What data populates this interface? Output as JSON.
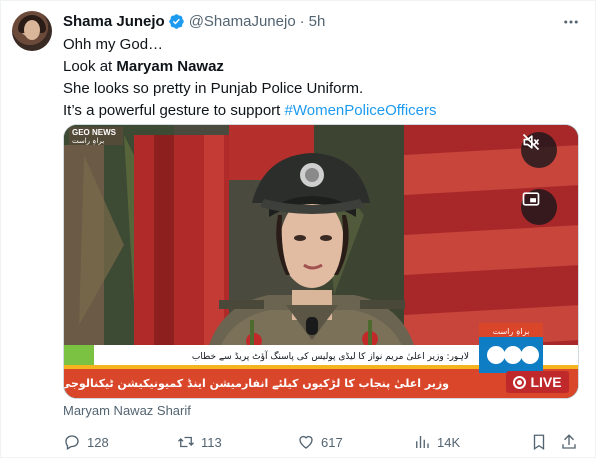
{
  "author": {
    "name": "Shama Junejo",
    "handle": "@ShamaJunejo",
    "separator": "·",
    "time": "5h"
  },
  "tweet": {
    "line1": "Ohh my God…",
    "line2_prefix": "Look at ",
    "line2_bold": "Maryam Nawaz",
    "line3": "She looks so pretty in Punjab Police Uniform.",
    "line4_prefix": "It’s a powerful gesture to support ",
    "hashtag": "#WomenPoliceOfficers"
  },
  "media": {
    "channel_logo": "GEO NEWS",
    "channel_sub": "براہِ راست",
    "ticker_top": "لاہور: وزیر اعلیٰ مریم نواز کا لیڈی پولیس کی پاسنگ آؤٹ پریڈ سے خطاب",
    "ticker_main": "وزیر اعلیٰ پنجاب کا لڑکیوں کیلئے انفارمیشن اینڈ کمیونیکیشن ٹیکنالوجی کے عالمی دن پر پیغام",
    "live_label": "LIVE",
    "live_badge": "براہِ راست"
  },
  "caption": "Maryam Nawaz Sharif",
  "actions": {
    "replies": "128",
    "reposts": "113",
    "likes": "617",
    "views": "14K"
  },
  "icons": [
    "verified-badge-icon",
    "more-icon",
    "mute-icon",
    "pip-icon",
    "reply-icon",
    "repost-icon",
    "like-icon",
    "views-icon",
    "bookmark-icon",
    "share-icon"
  ],
  "colors": {
    "accent": "#1d9bf0",
    "secondary_text": "#536471",
    "live_red": "#c0292b"
  }
}
